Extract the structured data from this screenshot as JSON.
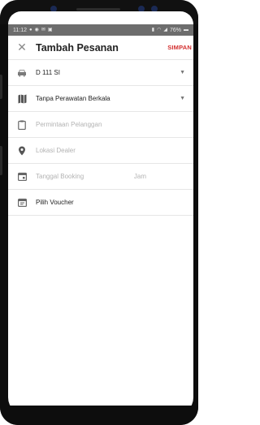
{
  "status_bar": {
    "time": "11:12",
    "left_icons": [
      "chat-icon",
      "whatsapp-icon",
      "gmail-icon",
      "image-icon"
    ],
    "right_text": "76%",
    "right_icons": [
      "vibrate-icon",
      "wifi-icon",
      "signal-icon",
      "battery-icon"
    ]
  },
  "app_bar": {
    "title": "Tambah Pesanan",
    "close_icon": "close-icon",
    "save_label": "SIMPAN"
  },
  "form": {
    "vehicle": {
      "icon": "car-icon",
      "value": "D 111 SI"
    },
    "service_type": {
      "icon": "map-icon",
      "value": "Tanpa Perawatan Berkala"
    },
    "customer_request": {
      "icon": "clipboard-icon",
      "placeholder": "Permintaan Pelanggan"
    },
    "dealer_location": {
      "icon": "location-pin-icon",
      "placeholder": "Lokasi Dealer"
    },
    "booking": {
      "icon": "calendar-icon",
      "date_placeholder": "Tanggal Booking",
      "time_placeholder": "Jam"
    },
    "voucher": {
      "icon": "voucher-icon",
      "label": "Pilih Voucher"
    }
  }
}
